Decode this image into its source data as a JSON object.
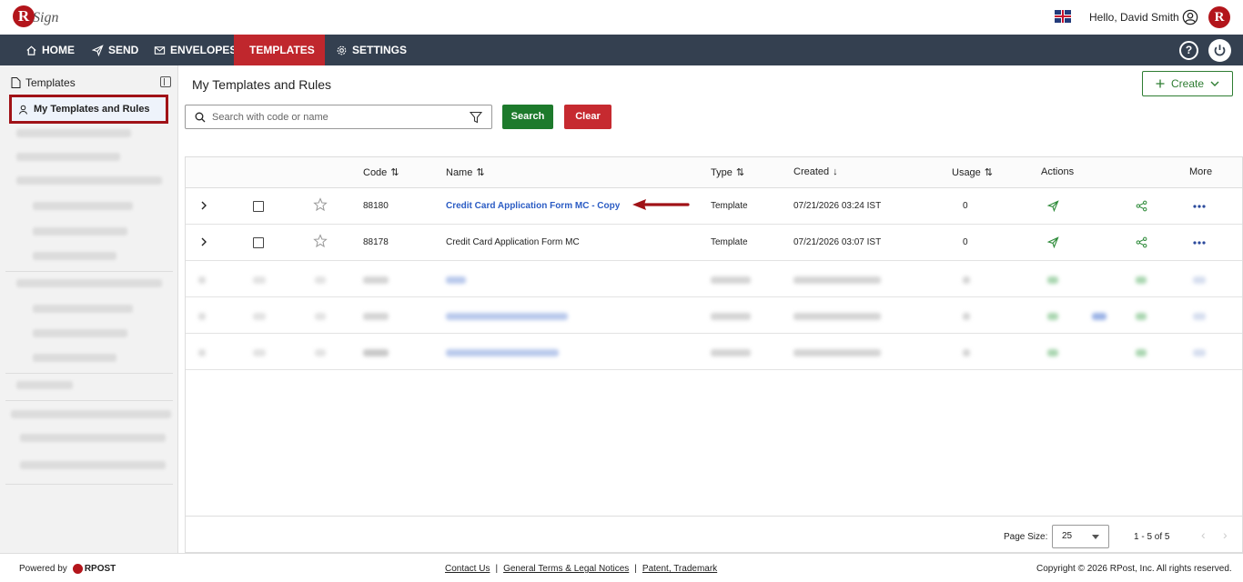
{
  "header": {
    "logo_text": "RSign",
    "greeting": "Hello, David Smith"
  },
  "nav": {
    "items": [
      {
        "label": "HOME",
        "icon": "home-icon"
      },
      {
        "label": "SEND",
        "icon": "send-icon"
      },
      {
        "label": "ENVELOPES",
        "icon": "envelope-icon"
      },
      {
        "label": "TEMPLATES",
        "icon": "document-icon",
        "active": true
      },
      {
        "label": "SETTINGS",
        "icon": "gear-icon"
      }
    ],
    "help_label": "?"
  },
  "sidebar": {
    "title": "Templates",
    "active_item": "My Templates and Rules"
  },
  "main": {
    "title": "My Templates and Rules",
    "create_label": "Create",
    "search": {
      "placeholder": "Search with code or name",
      "value": "",
      "search_label": "Search",
      "clear_label": "Clear"
    },
    "table": {
      "columns": [
        "Code",
        "Name",
        "Type",
        "Created",
        "Usage",
        "Actions",
        "More"
      ],
      "rows": [
        {
          "code": "88180",
          "name": "Credit Card Application Form MC - Copy",
          "type": "Template",
          "created": "07/21/2026 03:24 IST",
          "usage": "0"
        },
        {
          "code": "88178",
          "name": "Credit Card Application Form MC",
          "type": "Template",
          "created": "07/21/2026 03:07 IST",
          "usage": "0"
        }
      ]
    },
    "pager": {
      "page_size_label": "Page Size:",
      "page_size": "25",
      "range": "1 - 5 of 5"
    }
  },
  "footer": {
    "powered_by": "Powered by",
    "brand": "RPOST",
    "links": [
      "Contact Us",
      "General Terms & Legal Notices",
      "Patent, Trademark"
    ],
    "copyright": "Copyright © 2026 RPost, Inc. All rights reserved."
  },
  "colors": {
    "nav_bg": "#344050",
    "accent_red": "#c0272d",
    "search_green": "#1d7a2c",
    "link_blue": "#2b5cc4"
  }
}
